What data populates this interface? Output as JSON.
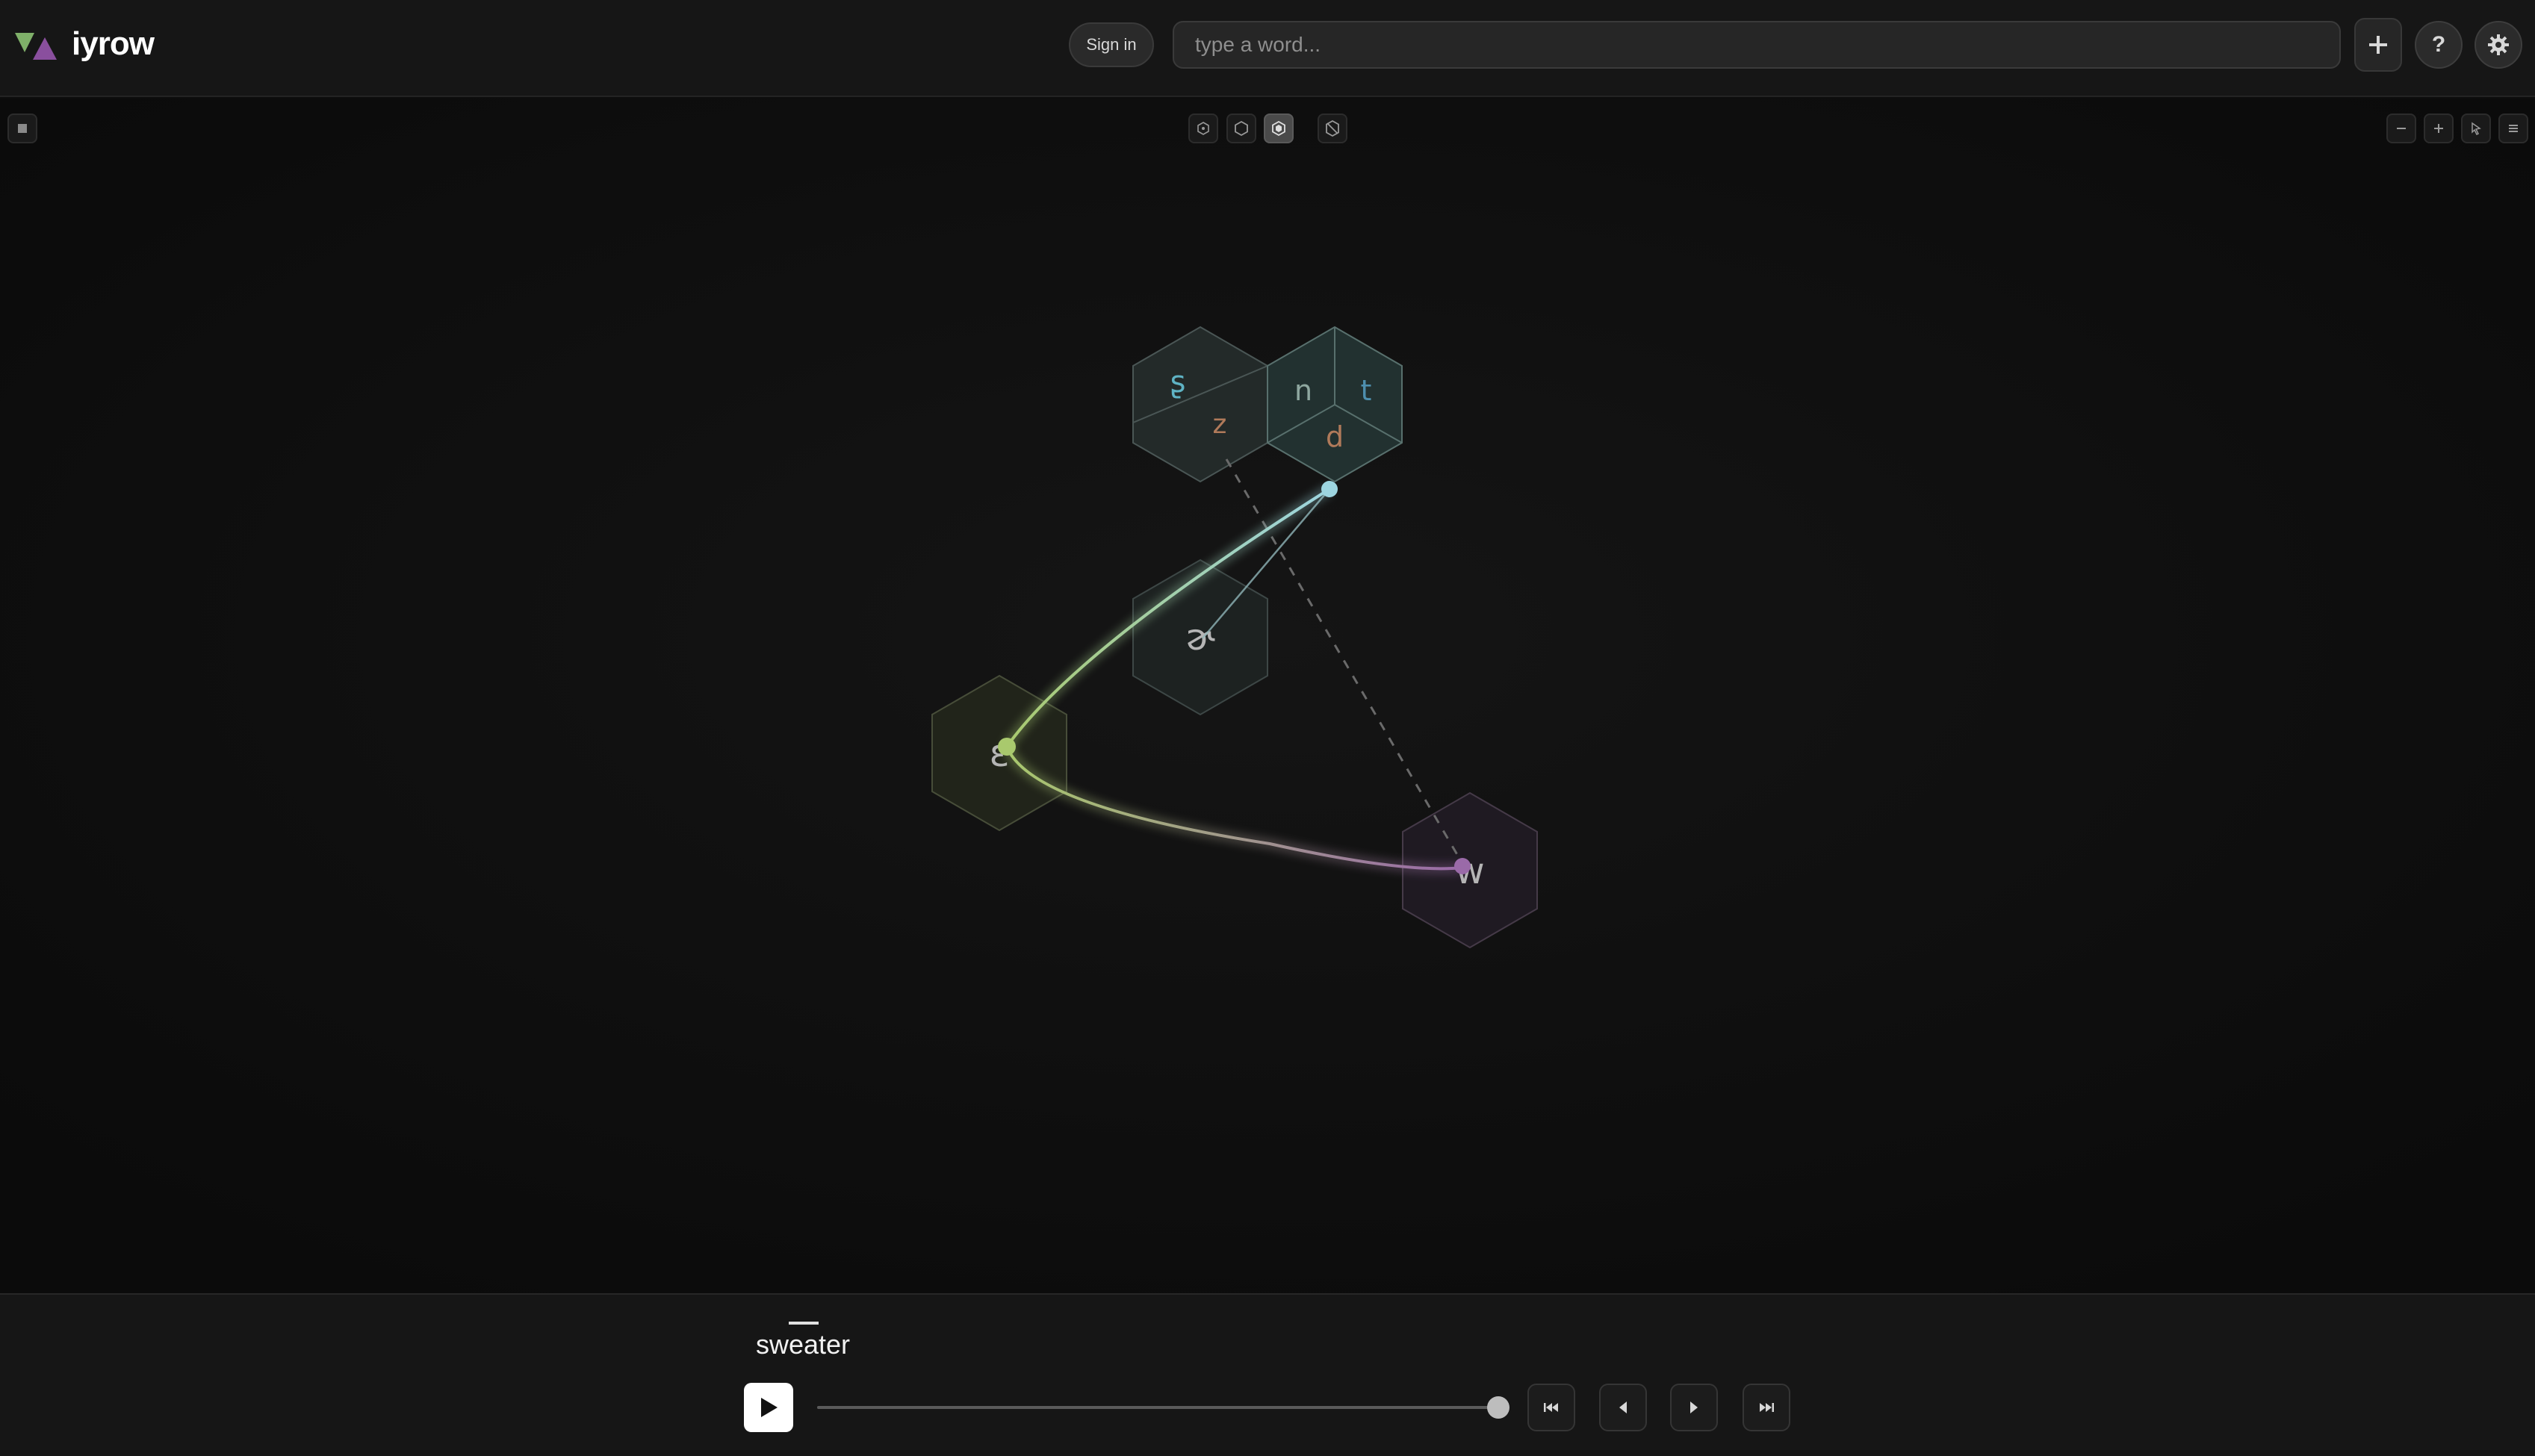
{
  "app": {
    "name": "iyrow",
    "sign_in_label": "Sign in",
    "search_placeholder": "type a word..."
  },
  "header_icons": [
    "plus-icon",
    "help-icon",
    "gear-icon"
  ],
  "help_glyph": "?",
  "toolbar": {
    "left": [
      "panel-toggle-icon"
    ],
    "center": [
      "hexagon-small-icon",
      "hexagon-outline-icon",
      "hexagon-filled-icon",
      "no-hexagon-icon"
    ],
    "center_active_index": 2,
    "right": [
      "zoom-out-icon",
      "zoom-in-icon",
      "pointer-icon",
      "menu-icon"
    ]
  },
  "diagram": {
    "tiles": [
      {
        "id": "tile-dental-fricatives",
        "glyphs": [
          {
            "text": "ʂ",
            "color": "#5fb3c4"
          },
          {
            "text": "z",
            "color": "#b07a5a"
          }
        ]
      },
      {
        "id": "tile-alveolars",
        "glyphs": [
          {
            "text": "n",
            "color": "#8fa8a0"
          },
          {
            "text": "t",
            "color": "#4e8fae"
          },
          {
            "text": "d",
            "color": "#b07a5a"
          }
        ]
      },
      {
        "id": "tile-schwa",
        "glyphs": [
          {
            "text": "ɚ",
            "color": "#b5b5b5"
          }
        ]
      },
      {
        "id": "tile-open-e",
        "glyphs": [
          {
            "text": "ɛ",
            "color": "#b5b5b5"
          }
        ]
      },
      {
        "id": "tile-w",
        "glyphs": [
          {
            "text": "w",
            "color": "#b5b5b5"
          }
        ]
      }
    ],
    "path_colors": {
      "start": "#9dd5e0",
      "middle": "#a9c96d",
      "end": "#9a6aa8"
    }
  },
  "player": {
    "word": "sweater",
    "progress": 1.0
  },
  "colors": {
    "logo_green": "#7fb069",
    "logo_purple": "#8a4f9e",
    "background": "#0d0d0d"
  }
}
